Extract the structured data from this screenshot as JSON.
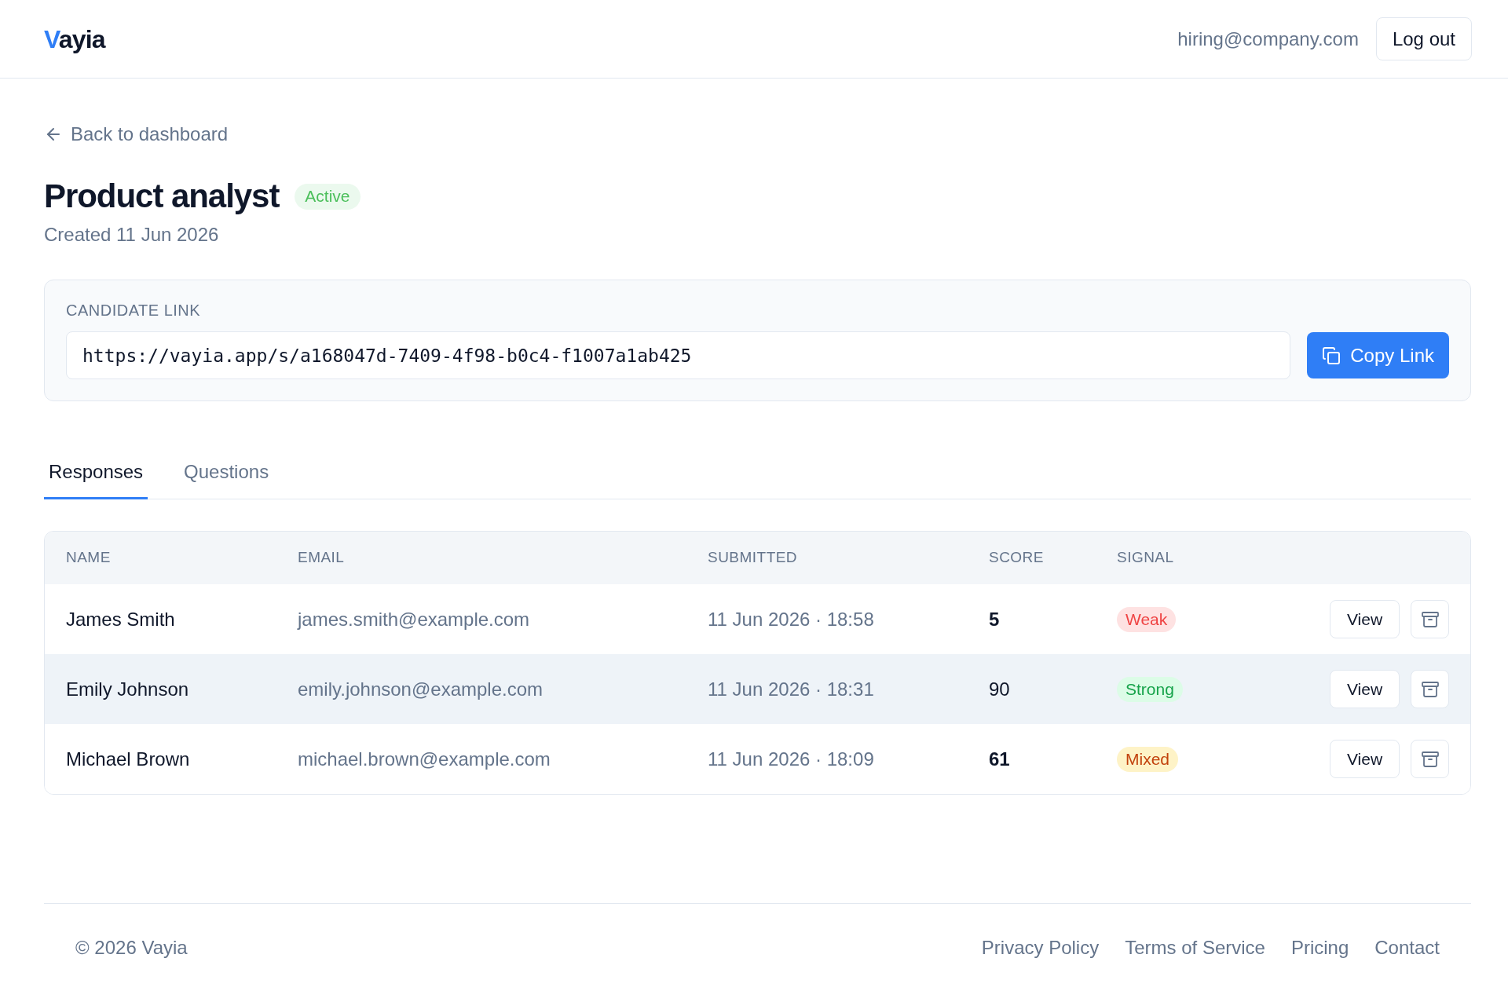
{
  "header": {
    "logo": {
      "accent": "V",
      "rest": "ayia"
    },
    "user_email": "hiring@company.com",
    "logout_button": "Log out"
  },
  "back_link": "Back to dashboard",
  "job": {
    "title": "Product analyst",
    "status": {
      "label": "Active",
      "kind": "active"
    },
    "created": "Created 11 Jun 2026"
  },
  "candidate_link": {
    "label": "CANDIDATE LINK",
    "value": "https://vayia.app/s/a168047d-7409-4f98-b0c4-f1007a1ab425",
    "button": "Copy Link"
  },
  "tabs": [
    {
      "label": "Responses",
      "selected": true
    },
    {
      "label": "Questions",
      "selected": false
    }
  ],
  "table": {
    "columns": [
      "NAME",
      "EMAIL",
      "SUBMITTED",
      "SCORE",
      "SIGNAL"
    ],
    "rows": [
      {
        "name": "James Smith",
        "email": "james.smith@example.com",
        "submitted": "11 Jun 2026 · 18:58",
        "score": "5",
        "score_bold": true,
        "signal": {
          "label": "Weak",
          "kind": "weak"
        },
        "highlighted": false,
        "view_button": "View"
      },
      {
        "name": "Emily Johnson",
        "email": "emily.johnson@example.com",
        "submitted": "11 Jun 2026 · 18:31",
        "score": "90",
        "score_bold": false,
        "signal": {
          "label": "Strong",
          "kind": "strong"
        },
        "highlighted": true,
        "view_button": "View"
      },
      {
        "name": "Michael Brown",
        "email": "michael.brown@example.com",
        "submitted": "11 Jun 2026 · 18:09",
        "score": "61",
        "score_bold": true,
        "signal": {
          "label": "Mixed",
          "kind": "mixed"
        },
        "highlighted": false,
        "view_button": "View"
      }
    ]
  },
  "footer": {
    "copyright": "© 2026 Vayia",
    "links": [
      "Privacy Policy",
      "Terms of Service",
      "Pricing",
      "Contact"
    ]
  }
}
